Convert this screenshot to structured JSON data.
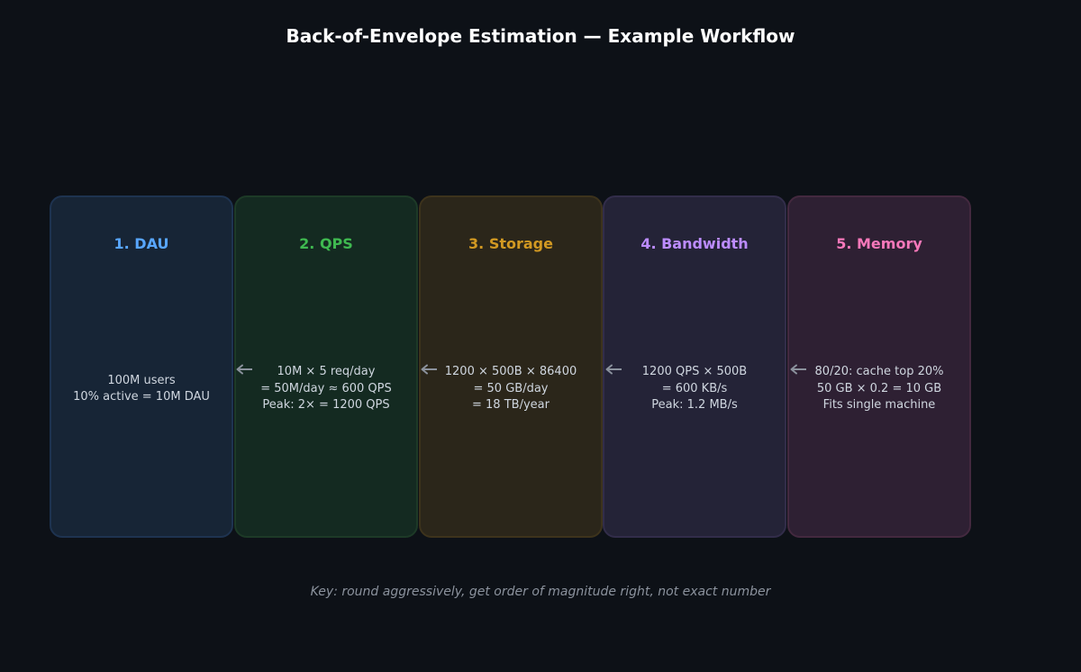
{
  "title": "Back-of-Envelope Estimation — Example Workflow",
  "steps": [
    {
      "title": "1. DAU",
      "lines": [
        "100M users",
        "10% active = 10M DAU"
      ],
      "accent": "#58a6ff",
      "bg": "#172536",
      "border": "#1e3350"
    },
    {
      "title": "2. QPS",
      "lines": [
        "10M × 5 req/day",
        "= 50M/day ≈ 600 QPS",
        "Peak: 2× = 1200 QPS"
      ],
      "accent": "#3fb950",
      "bg": "#142a21",
      "border": "#1d3a27"
    },
    {
      "title": "3. Storage",
      "lines": [
        "1200 × 500B × 86400",
        "= 50 GB/day",
        "= 18 TB/year"
      ],
      "accent": "#d29922",
      "bg": "#2b261a",
      "border": "#3d331c"
    },
    {
      "title": "4. Bandwidth",
      "lines": [
        "1200 QPS × 500B",
        "= 600 KB/s",
        "Peak: 1.2 MB/s"
      ],
      "accent": "#bc8cff",
      "bg": "#242337",
      "border": "#322d4a"
    },
    {
      "title": "5. Memory",
      "lines": [
        "80/20: cache top 20%",
        "50 GB × 0.2 = 10 GB",
        "Fits single machine"
      ],
      "accent": "#f778ba",
      "bg": "#2e2033",
      "border": "#43293f"
    }
  ],
  "arrow_color": "#8b929d",
  "footnote": "Key: round aggressively, get order of magnitude right, not exact number"
}
